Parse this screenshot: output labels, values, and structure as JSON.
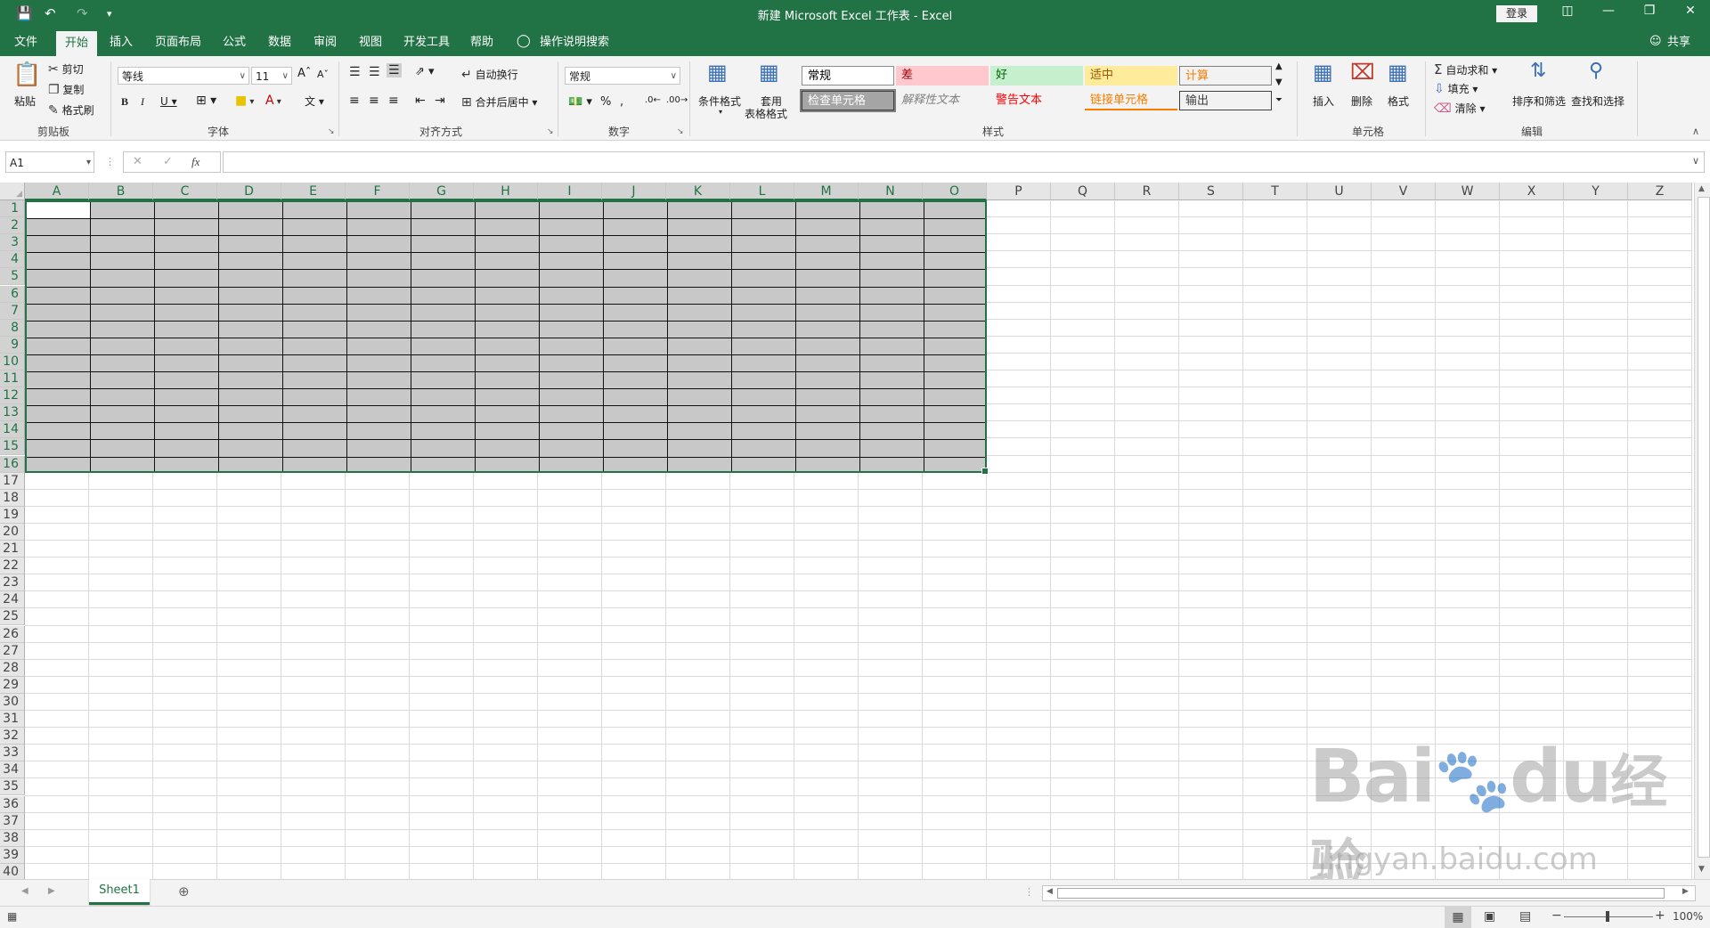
{
  "window": {
    "title": "新建 Microsoft Excel 工作表 - Excel",
    "login_label": "登录",
    "share_label": "共享"
  },
  "tabs": [
    "文件",
    "开始",
    "插入",
    "页面布局",
    "公式",
    "数据",
    "审阅",
    "视图",
    "开发工具",
    "帮助"
  ],
  "active_tab": "开始",
  "tell_me": "操作说明搜索",
  "ribbon": {
    "clipboard": {
      "paste": "粘贴",
      "cut": "剪切",
      "copy": "复制",
      "format_painter": "格式刷",
      "label": "剪贴板"
    },
    "font": {
      "name": "等线",
      "size": "11",
      "label": "字体"
    },
    "alignment": {
      "wrap": "自动换行",
      "merge": "合并后居中",
      "label": "对齐方式"
    },
    "number": {
      "format": "常规",
      "label": "数字"
    },
    "styles": {
      "conditional": "条件格式",
      "table_format_1": "套用",
      "table_format_2": "表格格式",
      "cells": [
        {
          "text": "常规",
          "bg": "#ffffff",
          "fg": "#000000",
          "border": "#8e8e8e"
        },
        {
          "text": "差",
          "bg": "#ffc7ce",
          "fg": "#9c0006",
          "border": ""
        },
        {
          "text": "好",
          "bg": "#c6efce",
          "fg": "#006100",
          "border": ""
        },
        {
          "text": "适中",
          "bg": "#ffeb9c",
          "fg": "#9c5700",
          "border": ""
        },
        {
          "text": "计算",
          "bg": "#f2f2f2",
          "fg": "#fa7d00",
          "border": "#7f7f7f"
        },
        {
          "text": "检查单元格",
          "bg": "#a5a5a5",
          "fg": "#ffffff",
          "border": "#3f3f3f"
        },
        {
          "text": "解释性文本",
          "bg": "#f3f3f3",
          "fg": "#7f7f7f",
          "border": ""
        },
        {
          "text": "警告文本",
          "bg": "#f3f3f3",
          "fg": "#ff0000",
          "border": ""
        },
        {
          "text": "链接单元格",
          "bg": "#f3f3f3",
          "fg": "#fa7d00",
          "border": ""
        },
        {
          "text": "输出",
          "bg": "#f2f2f2",
          "fg": "#3f3f3f",
          "border": "#3f3f3f"
        }
      ],
      "label": "样式"
    },
    "cells": {
      "insert": "插入",
      "delete": "删除",
      "format": "格式",
      "label": "单元格"
    },
    "editing": {
      "autosum": "自动求和",
      "fill": "填充",
      "clear": "清除",
      "sort": "排序和筛选",
      "find": "查找和选择",
      "label": "编辑"
    }
  },
  "formula_bar": {
    "name_box": "A1",
    "fx": "fx",
    "value": ""
  },
  "columns": [
    "A",
    "B",
    "C",
    "D",
    "E",
    "F",
    "G",
    "H",
    "I",
    "J",
    "K",
    "L",
    "M",
    "N",
    "O",
    "P",
    "Q",
    "R",
    "S",
    "T",
    "U",
    "V",
    "W",
    "X",
    "Y",
    "Z"
  ],
  "rows": [
    "1",
    "2",
    "3",
    "4",
    "5",
    "6",
    "7",
    "8",
    "9",
    "10",
    "11",
    "12",
    "13",
    "14",
    "15",
    "16",
    "17",
    "18",
    "19",
    "20",
    "21",
    "22",
    "23",
    "24",
    "25",
    "26",
    "27",
    "28",
    "29",
    "30",
    "31",
    "32",
    "33",
    "34",
    "35",
    "36",
    "37",
    "38",
    "39",
    "40"
  ],
  "selection": {
    "range": "A1:O16",
    "fill_color": "#c8c8c8",
    "accent": "#217346"
  },
  "sheet_tabs": [
    "Sheet1"
  ],
  "status": {
    "zoom": "100%"
  },
  "watermark": {
    "brand": "Bai",
    "brand2": "du",
    "brand_cn": "经验",
    "url": "jingyan.baidu.com"
  }
}
